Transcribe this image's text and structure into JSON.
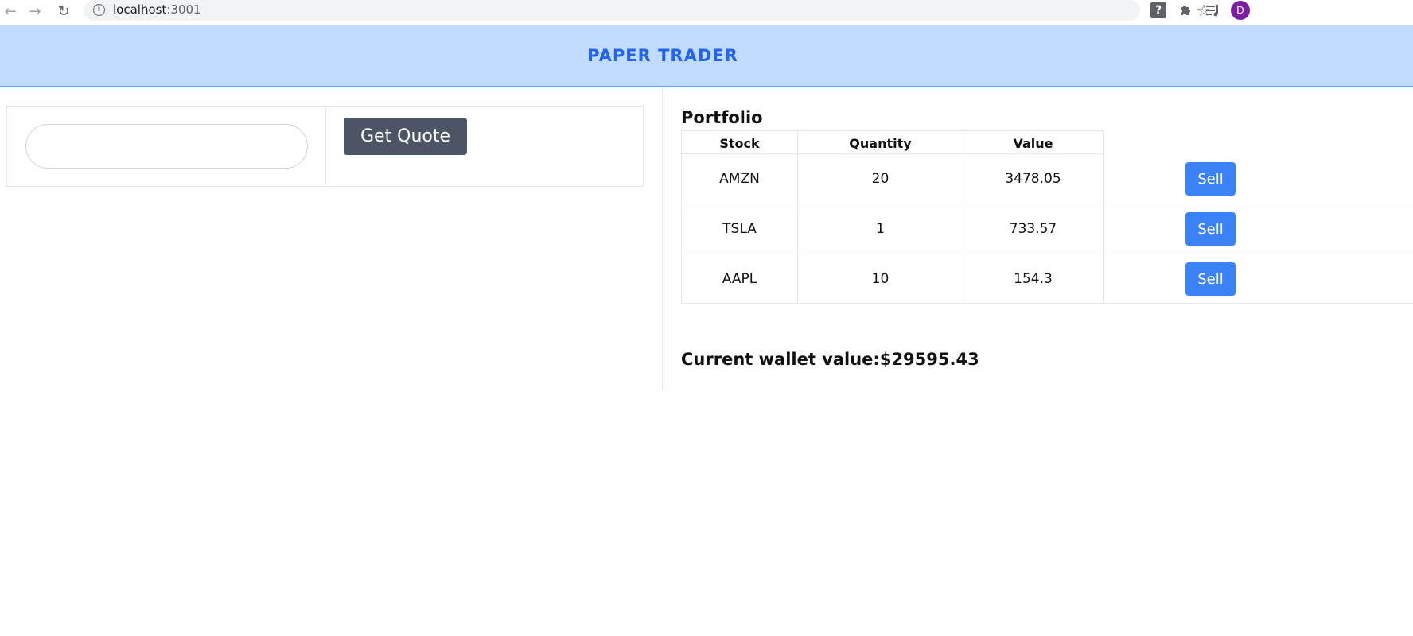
{
  "browser": {
    "url_host": "localhost",
    "url_port": ":3001",
    "profile_initial": "D"
  },
  "header": {
    "title": "PAPER TRADER"
  },
  "quote": {
    "input_value": "",
    "button_label": "Get Quote"
  },
  "portfolio": {
    "title": "Portfolio",
    "columns": [
      "Stock",
      "Quantity",
      "Value"
    ],
    "rows": [
      {
        "stock": "AMZN",
        "quantity": "20",
        "value": "3478.05",
        "action": "Sell"
      },
      {
        "stock": "TSLA",
        "quantity": "1",
        "value": "733.57",
        "action": "Sell"
      },
      {
        "stock": "AAPL",
        "quantity": "10",
        "value": "154.3",
        "action": "Sell"
      }
    ]
  },
  "wallet": {
    "text": "Current wallet value:$29595.43"
  },
  "colors": {
    "header_bg": "#bfdbfe",
    "title": "#2563eb",
    "quote_button": "#4b5563",
    "sell_button": "#3b82f6"
  }
}
